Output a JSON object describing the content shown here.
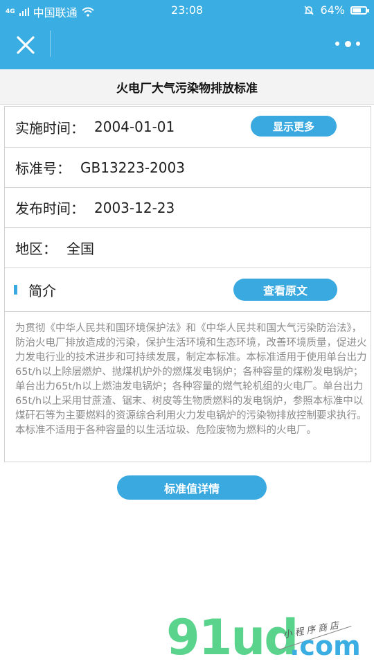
{
  "status_bar": {
    "signal": "4G",
    "carrier": "中国联通",
    "time": "23:08",
    "battery": "64%",
    "battery_level": 0.64
  },
  "nav": {
    "close_icon": "close-icon",
    "more_icon": "more-dots-icon"
  },
  "page": {
    "title": "火电厂大气污染物排放标准"
  },
  "info": {
    "impl_label": "实施时间：",
    "impl_value": "2004-01-01",
    "show_more": "显示更多",
    "std_label": "标准号：",
    "std_value": "GB13223-2003",
    "pub_label": "发布时间：",
    "pub_value": "2003-12-23",
    "region_label": "地区：",
    "region_value": "全国",
    "intro_label": "简介",
    "view_original": "查看原文"
  },
  "description": "为贯彻《中华人民共和国环境保护法》和《中华人民共和国大气污染防治法》，防治火电厂排放造成的污染，保护生活环境和生态环境，改善环境质量，促进火力发电行业的技术进步和可持续发展，制定本标准。本标准适用于使用单台出力65t/h以上除层燃炉、抛煤机炉外的燃煤发电锅炉；各种容量的煤粉发电锅炉；单台出力65t/h以上燃油发电锅炉；各种容量的燃气轮机组的火电厂。单台出力65t/h以上采用甘蔗渣、锯末、树皮等生物质燃料的发电锅炉，参照本标准中以煤矸石等为主要燃料的资源综合利用火力发电锅炉的污染物排放控制要求执行。本标准不适用于各种容量的以生活垃圾、危险废物为燃料的火电厂。",
  "detail_button": "标准值详情",
  "watermark": {
    "logo_main": "91ud",
    "logo_tld": ".com",
    "tagline": "小程序商店"
  },
  "colors": {
    "accent": "#3aaee3",
    "button": "#39a9e0"
  }
}
